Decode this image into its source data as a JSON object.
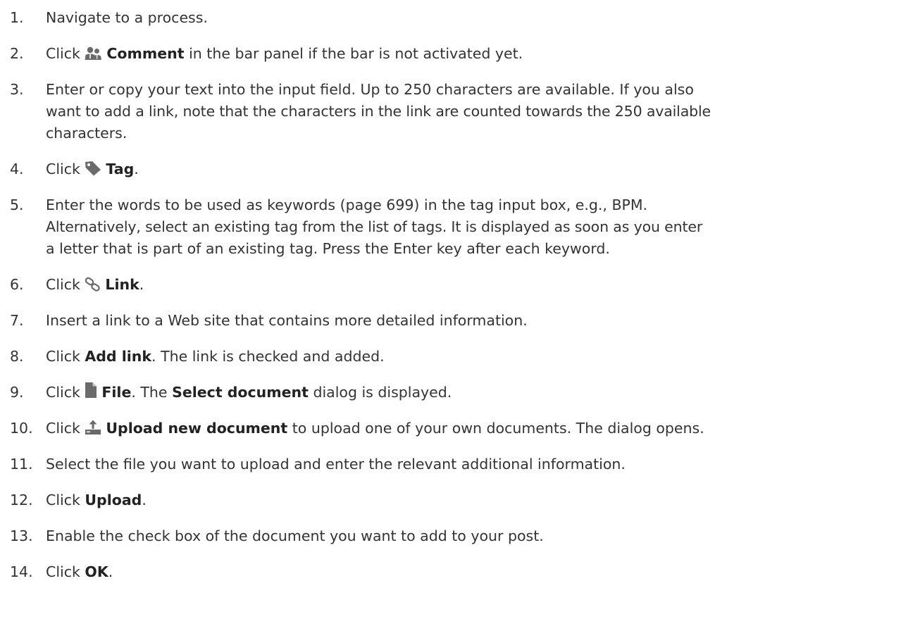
{
  "steps": [
    {
      "number": "1.",
      "text": "Navigate to a process."
    },
    {
      "number": "2.",
      "pre": "Click",
      "icon": "users-icon",
      "bold": "Comment",
      "post": "in the bar panel if the bar is not activated yet."
    },
    {
      "number": "3.",
      "lines": [
        "Enter or copy your text into the input field. Up to 250 characters are available. If you also",
        "want to add a link, note that the characters in the link are counted towards the 250 available",
        "characters."
      ]
    },
    {
      "number": "4.",
      "pre": "Click",
      "icon": "tag-icon",
      "bold": "Tag",
      "post": "."
    },
    {
      "number": "5.",
      "lines": [
        "Enter the words to be used as keywords (page 699) in the tag input box, e.g., BPM.",
        "Alternatively, select an existing tag from the list of tags. It is displayed as soon as you enter",
        "a letter that is part of an existing tag. Press the Enter key after each keyword."
      ]
    },
    {
      "number": "6.",
      "pre": "Click",
      "icon": "link-icon",
      "bold": "Link",
      "post": "."
    },
    {
      "number": "7.",
      "text": "Insert a link to a Web site that contains more detailed information."
    },
    {
      "number": "8.",
      "pre": "Click",
      "bold": "Add link",
      "post": ". The link is checked and added."
    },
    {
      "number": "9.",
      "pre": "Click",
      "icon": "file-icon",
      "bold": "File",
      "post": ". The",
      "bold2": "Select document",
      "post2": "dialog is displayed."
    },
    {
      "number": "10.",
      "pre": "Click",
      "icon": "upload-icon",
      "bold": "Upload new document",
      "post": "to upload one of your own documents. The dialog opens."
    },
    {
      "number": "11.",
      "text": "Select the file you want to upload and enter the relevant additional information."
    },
    {
      "number": "12.",
      "pre": "Click",
      "bold": "Upload",
      "post": "."
    },
    {
      "number": "13.",
      "text": "Enable the check box of the document you want to add to your post."
    },
    {
      "number": "14.",
      "pre": "Click",
      "bold": "OK",
      "post": "."
    }
  ],
  "icon_color": "#6a6a6a"
}
